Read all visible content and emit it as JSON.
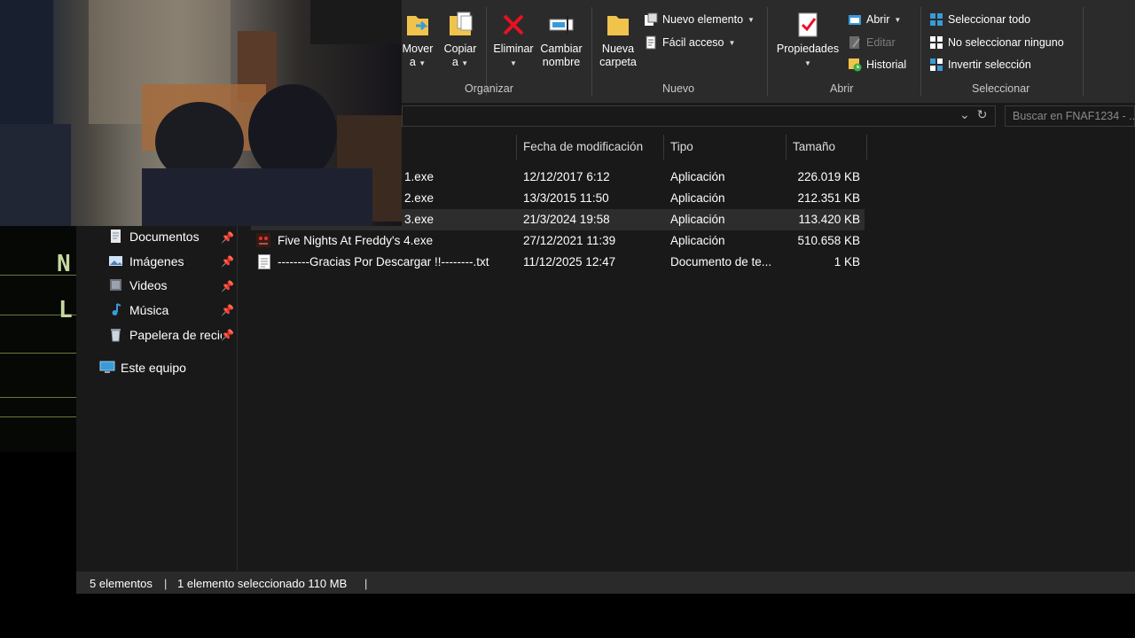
{
  "ribbon": {
    "groups": {
      "organizar": "Organizar",
      "nuevo": "Nuevo",
      "abrir": "Abrir",
      "seleccionar": "Seleccionar"
    },
    "mover": [
      "Mover",
      "a"
    ],
    "copiar": [
      "Copiar",
      "a"
    ],
    "eliminar": "Eliminar",
    "cambiar": [
      "Cambiar",
      "nombre"
    ],
    "nueva_carpeta": [
      "Nueva",
      "carpeta"
    ],
    "nuevo_elemento": "Nuevo elemento",
    "facil_acceso": "Fácil acceso",
    "propiedades": "Propiedades",
    "abrir": "Abrir",
    "editar": "Editar",
    "historial": "Historial",
    "seleccionar_todo": "Seleccionar todo",
    "no_seleccionar": "No seleccionar ninguno",
    "invertir": "Invertir selección"
  },
  "search": {
    "placeholder": "Buscar en FNAF1234 - ..."
  },
  "nav": {
    "items": [
      {
        "label": "Documentos",
        "icon": "documents-icon",
        "pinned": true
      },
      {
        "label": "Imágenes",
        "icon": "pictures-icon",
        "pinned": true
      },
      {
        "label": "Videos",
        "icon": "videos-icon",
        "pinned": true
      },
      {
        "label": "Música",
        "icon": "music-icon",
        "pinned": true
      },
      {
        "label": "Papelera de recic",
        "icon": "recycle-bin-icon",
        "pinned": true
      }
    ],
    "este_equipo": "Este equipo"
  },
  "columns": {
    "fecha": "Fecha de modificación",
    "tipo": "Tipo",
    "tamano": "Tamaño"
  },
  "files": [
    {
      "name": "1.exe",
      "date": "12/12/2017 6:12",
      "type": "Aplicación",
      "size": "226.019 KB",
      "selected": false
    },
    {
      "name": "2.exe",
      "date": "13/3/2015 11:50",
      "type": "Aplicación",
      "size": "212.351 KB",
      "selected": false
    },
    {
      "name": "3.exe",
      "date": "21/3/2024 19:58",
      "type": "Aplicación",
      "size": "113.420 KB",
      "selected": true
    },
    {
      "name": "Five Nights At Freddy's 4.exe",
      "date": "27/12/2021 11:39",
      "type": "Aplicación",
      "size": "510.658 KB",
      "selected": false
    },
    {
      "name": "--------Gracias Por Descargar !!--------.txt",
      "date": "11/12/2025 12:47",
      "type": "Documento de te...",
      "size": "1 KB",
      "selected": false
    }
  ],
  "status": {
    "count": "5 elementos",
    "selection": "1 elemento seleccionado  110 MB",
    "separator": "|"
  },
  "colors": {
    "background": "#191919",
    "ribbon": "#2b2b2b",
    "selected_row": "#2d2d2d",
    "delete_red": "#e81123",
    "folder_yellow": "#f0c44c"
  }
}
